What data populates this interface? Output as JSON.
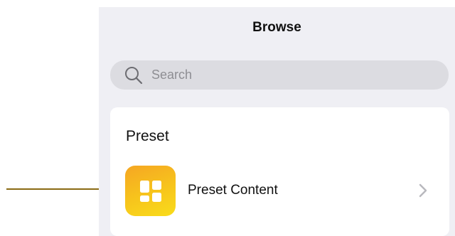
{
  "nav": {
    "title": "Browse"
  },
  "search": {
    "placeholder": "Search"
  },
  "section": {
    "header": "Preset",
    "items": [
      {
        "label": "Preset Content",
        "icon": "preset-grid-icon"
      }
    ]
  },
  "colors": {
    "panel_background": "#efeff4",
    "search_background": "#dcdce1",
    "icon_gradient_start": "#f5a623",
    "icon_gradient_end": "#f9dc1b",
    "callout_line": "#8a6a14"
  }
}
